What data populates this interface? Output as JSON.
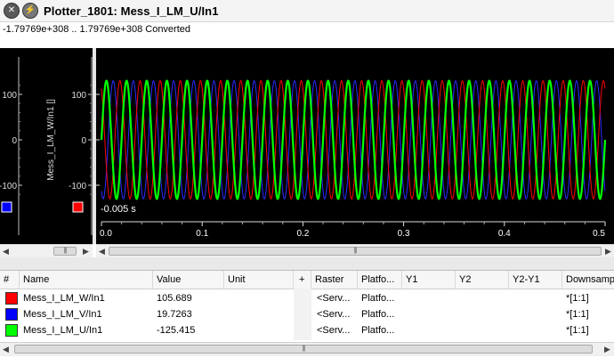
{
  "window": {
    "title": "Plotter_1801:  Mess_I_LM_U/In1",
    "range_text": "-1.79769e+308 .. 1.79769e+308  Converted"
  },
  "icons": {
    "close": "close-icon",
    "info": "info-icon",
    "scroll_left": "chevron-left-icon",
    "scroll_right": "chevron-right-icon",
    "grip": "grip-icon"
  },
  "left_axis": {
    "ticks": [
      "100",
      "0",
      "-100"
    ],
    "ylabel": "Mess_I_LM_W/In1 []"
  },
  "mini_axis": {
    "ticks": [
      "100",
      "0",
      "-100"
    ]
  },
  "chart_data": {
    "type": "line",
    "title": "",
    "xlabel": "",
    "ylabel": "",
    "xlim": [
      0.0,
      0.5
    ],
    "ylim": [
      -140,
      140
    ],
    "grid": false,
    "x_tick_labels": [
      "0.0",
      "0.1",
      "0.2",
      "0.3",
      "0.4",
      "0.5"
    ],
    "y_tick_labels": [
      "100",
      "0",
      "-100"
    ],
    "cursor_label": "-0.005 s",
    "series": [
      {
        "name": "Mess_I_LM_W/In1",
        "color": "#ff0000",
        "amplitude": 130,
        "frequency_hz": 50,
        "phase_deg": 120
      },
      {
        "name": "Mess_I_LM_V/In1",
        "color": "#2a2aff",
        "amplitude": 130,
        "frequency_hz": 50,
        "phase_deg": 240
      },
      {
        "name": "Mess_I_LM_U/In1",
        "color": "#00ff00",
        "amplitude": 130,
        "frequency_hz": 50,
        "phase_deg": 0
      }
    ]
  },
  "table": {
    "headers": [
      "#",
      "Name",
      "Value",
      "Unit",
      "+",
      "Raster",
      "Platfo...",
      "Y1",
      "Y2",
      "Y2-Y1",
      "Downsamp"
    ],
    "rows": [
      {
        "color": "#ff0000",
        "name": "Mess_I_LM_W/In1",
        "value": "105.689",
        "unit": "",
        "raster": "<Serv...",
        "platform": "Platfo...",
        "y1": "",
        "y2": "",
        "y2y1": "",
        "downsample": "*[1:1]"
      },
      {
        "color": "#0000ff",
        "name": "Mess_I_LM_V/In1",
        "value": "19.7263",
        "unit": "",
        "raster": "<Serv...",
        "platform": "Platfo...",
        "y1": "",
        "y2": "",
        "y2y1": "",
        "downsample": "*[1:1]"
      },
      {
        "color": "#00ff00",
        "name": "Mess_I_LM_U/In1",
        "value": "-125.415",
        "unit": "",
        "raster": "<Serv...",
        "platform": "Platfo...",
        "y1": "",
        "y2": "",
        "y2y1": "",
        "downsample": "*[1:1]"
      }
    ]
  },
  "left_panel": {
    "blue_marker_color": "#0000ff",
    "red_marker_color": "#ff0000"
  }
}
